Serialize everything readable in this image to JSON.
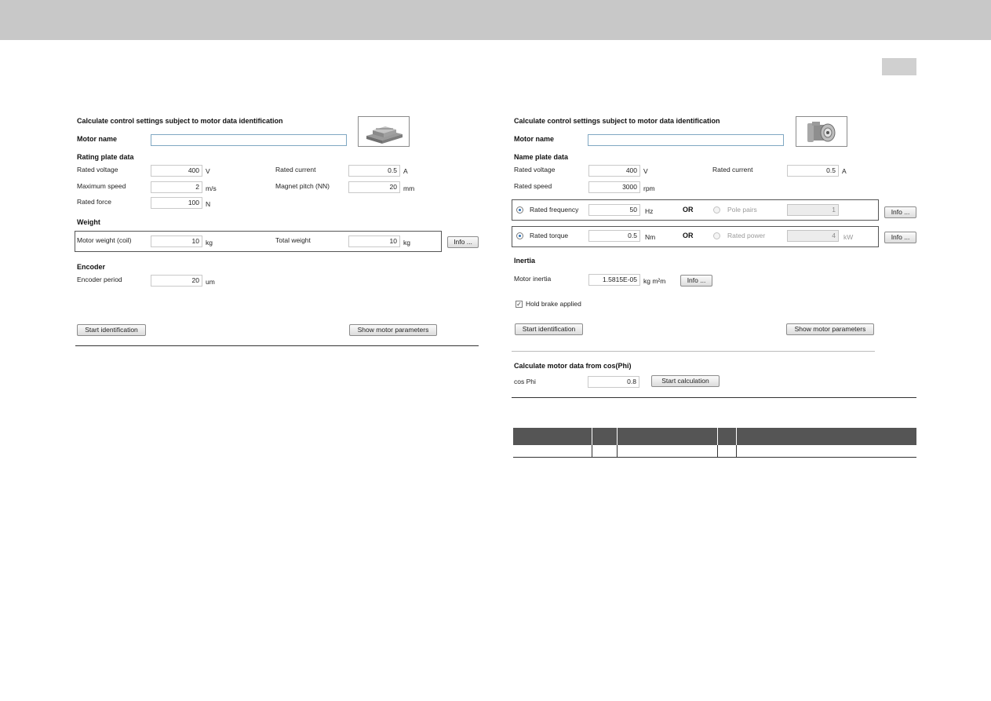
{
  "left": {
    "heading": "Calculate control settings subject to motor data identification",
    "motor_name_label": "Motor name",
    "motor_name_value": "",
    "image_icon": "linear-motor-icon",
    "rating_title": "Rating plate data",
    "rated_voltage_label": "Rated voltage",
    "rated_voltage_value": "400",
    "rated_voltage_unit": "V",
    "rated_current_label": "Rated current",
    "rated_current_value": "0.5",
    "rated_current_unit": "A",
    "max_speed_label": "Maximum speed",
    "max_speed_value": "2",
    "max_speed_unit": "m/s",
    "magnet_pitch_label": "Magnet pitch (NN)",
    "magnet_pitch_value": "20",
    "magnet_pitch_unit": "mm",
    "rated_force_label": "Rated force",
    "rated_force_value": "100",
    "rated_force_unit": "N",
    "weight_title": "Weight",
    "motor_weight_label": "Motor weight (coil)",
    "motor_weight_value": "10",
    "motor_weight_unit": "kg",
    "total_weight_label": "Total weight",
    "total_weight_value": "10",
    "total_weight_unit": "kg",
    "info_label": "Info ...",
    "encoder_title": "Encoder",
    "encoder_period_label": "Encoder period",
    "encoder_period_value": "20",
    "encoder_period_unit": "um",
    "start_identification": "Start identification",
    "show_parameters": "Show motor parameters"
  },
  "right": {
    "heading": "Calculate control settings subject to motor data identification",
    "motor_name_label": "Motor name",
    "motor_name_value": "",
    "image_icon": "rotary-motor-icon",
    "nameplate_title": "Name plate data",
    "rated_voltage_label": "Rated voltage",
    "rated_voltage_value": "400",
    "rated_voltage_unit": "V",
    "rated_current_label": "Rated current",
    "rated_current_value": "0.5",
    "rated_current_unit": "A",
    "rated_speed_label": "Rated speed",
    "rated_speed_value": "3000",
    "rated_speed_unit": "rpm",
    "rated_frequency_label": "Rated frequency",
    "rated_frequency_value": "50",
    "rated_frequency_unit": "Hz",
    "or_label": "OR",
    "pole_pairs_label": "Pole pairs",
    "pole_pairs_value": "1",
    "rated_torque_label": "Rated torque",
    "rated_torque_value": "0.5",
    "rated_torque_unit": "Nm",
    "rated_power_label": "Rated power",
    "rated_power_value": "4",
    "rated_power_unit": "kW",
    "info_label": "Info ...",
    "inertia_title": "Inertia",
    "motor_inertia_label": "Motor inertia",
    "motor_inertia_value": "1.5815E-05",
    "motor_inertia_unit": "kg m²m",
    "hold_brake_label": "Hold brake applied",
    "hold_brake_checked": true,
    "start_identification": "Start identification",
    "show_parameters": "Show motor parameters",
    "cosphi_title": "Calculate motor data from cos(Phi)",
    "cosphi_label": "cos Phi",
    "cosphi_value": "0.8",
    "start_calculation": "Start calculation"
  },
  "colors": {
    "topbar": "#c8c8c8",
    "table_header": "#555555",
    "field_border": "#c9c9c9",
    "name_field_border": "#7fa7c2",
    "radio_selected": "#2a6fb8"
  }
}
